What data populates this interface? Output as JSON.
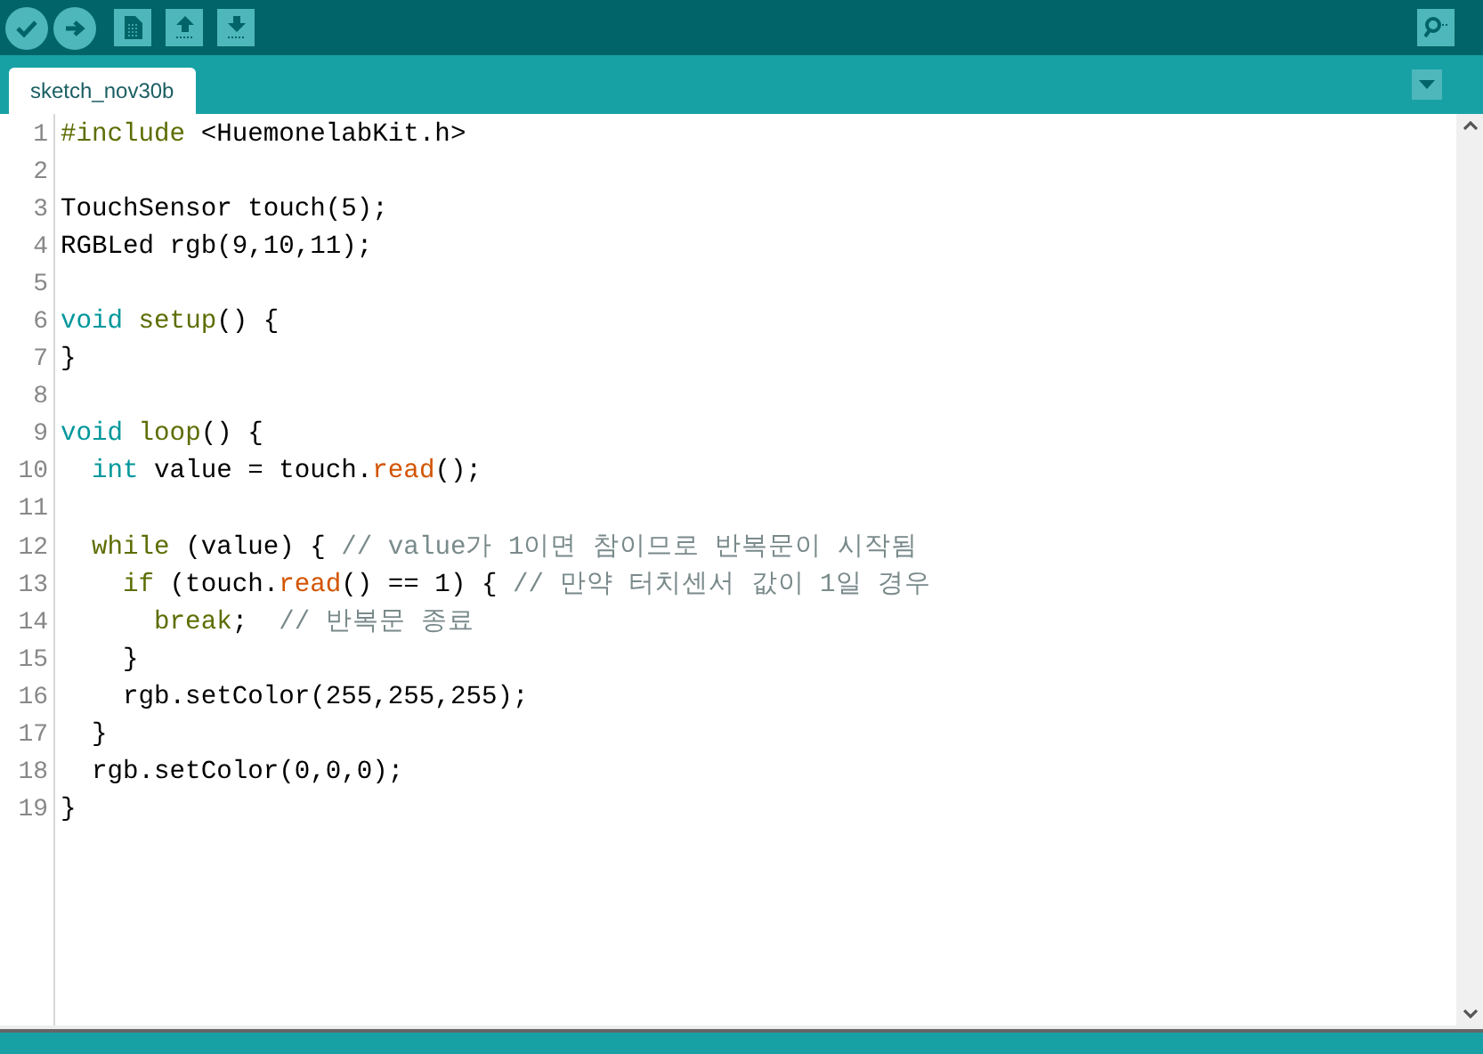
{
  "tabs": [
    {
      "label": "sketch_nov30b",
      "selected": true
    }
  ],
  "editor": {
    "lines": [
      {
        "number": "1",
        "tokens": [
          {
            "text": "#include",
            "kind": "keyword"
          },
          {
            "text": " <HuemonelabKit.h>",
            "kind": "plain"
          }
        ]
      },
      {
        "number": "2"
      },
      {
        "number": "3",
        "tokens": [
          {
            "text": "TouchSensor touch(5);",
            "kind": "plain"
          }
        ]
      },
      {
        "number": "4",
        "tokens": [
          {
            "text": "RGBLed rgb(9,10,11);",
            "kind": "plain"
          }
        ]
      },
      {
        "number": "5"
      },
      {
        "number": "6",
        "tokens": [
          {
            "text": "void ",
            "kind": "type"
          },
          {
            "text": "setup",
            "kind": "keyword"
          },
          {
            "text": "() {",
            "kind": "plain"
          }
        ]
      },
      {
        "number": "7",
        "tokens": [
          {
            "text": "}",
            "kind": "plain"
          }
        ]
      },
      {
        "number": "8"
      },
      {
        "number": "9",
        "tokens": [
          {
            "text": "void ",
            "kind": "type"
          },
          {
            "text": "loop",
            "kind": "keyword"
          },
          {
            "text": "() {",
            "kind": "plain"
          }
        ]
      },
      {
        "number": "10",
        "tokens": [
          {
            "text": "  int",
            "kind": "type"
          },
          {
            "text": " value = touch.",
            "kind": "plain"
          },
          {
            "text": "read",
            "kind": "function"
          },
          {
            "text": "();",
            "kind": "plain"
          }
        ]
      },
      {
        "number": "11"
      },
      {
        "number": "12",
        "tokens": [
          {
            "text": "  while",
            "kind": "keyword"
          },
          {
            "text": " (value) { ",
            "kind": "plain"
          },
          {
            "text": "// value가 1이면 참이므로 반복문이 시작됨",
            "kind": "comment"
          }
        ]
      },
      {
        "number": "13",
        "tokens": [
          {
            "text": "    if",
            "kind": "keyword"
          },
          {
            "text": " (touch.",
            "kind": "plain"
          },
          {
            "text": "read",
            "kind": "function"
          },
          {
            "text": "() == 1) { ",
            "kind": "plain"
          },
          {
            "text": "// 만약 터치센서 값이 1일 경우",
            "kind": "comment"
          }
        ]
      },
      {
        "number": "14",
        "tokens": [
          {
            "text": "      break",
            "kind": "keyword"
          },
          {
            "text": ";  ",
            "kind": "plain"
          },
          {
            "text": "// 반복문 종료",
            "kind": "comment"
          }
        ]
      },
      {
        "number": "15",
        "tokens": [
          {
            "text": "    }",
            "kind": "plain"
          }
        ]
      },
      {
        "number": "16",
        "tokens": [
          {
            "text": "    rgb.setColor(255,255,255);",
            "kind": "plain"
          }
        ]
      },
      {
        "number": "17",
        "tokens": [
          {
            "text": "  }",
            "kind": "plain"
          }
        ]
      },
      {
        "number": "18",
        "tokens": [
          {
            "text": "  rgb.setColor(0,0,0);",
            "kind": "plain"
          }
        ]
      },
      {
        "number": "19",
        "tokens": [
          {
            "text": "}",
            "kind": "plain"
          }
        ]
      }
    ]
  }
}
